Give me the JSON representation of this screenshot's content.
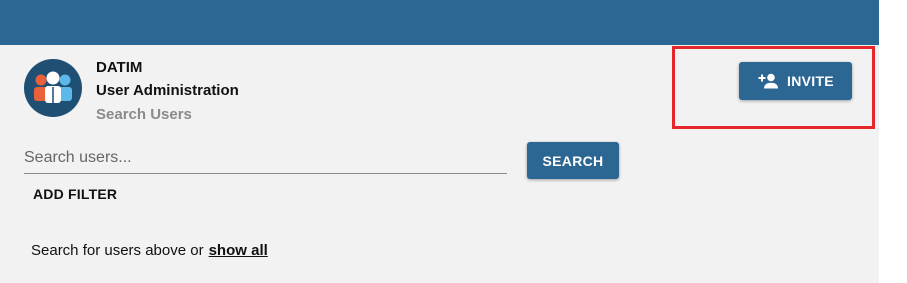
{
  "header": {
    "app_name": "DATIM",
    "app_subtitle": "User Administration",
    "page_title": "Search Users",
    "logo_icon": "users-group-icon"
  },
  "invite": {
    "label": "INVITE",
    "icon": "person-add-icon"
  },
  "search": {
    "placeholder": "Search users...",
    "value": "",
    "button_label": "SEARCH"
  },
  "filter": {
    "add_label": "ADD FILTER"
  },
  "hint": {
    "text": "Search for users above or",
    "link_label": "show all"
  },
  "colors": {
    "primary": "#2c6693",
    "background": "#f2f2f2",
    "highlight": "#e5262b"
  }
}
